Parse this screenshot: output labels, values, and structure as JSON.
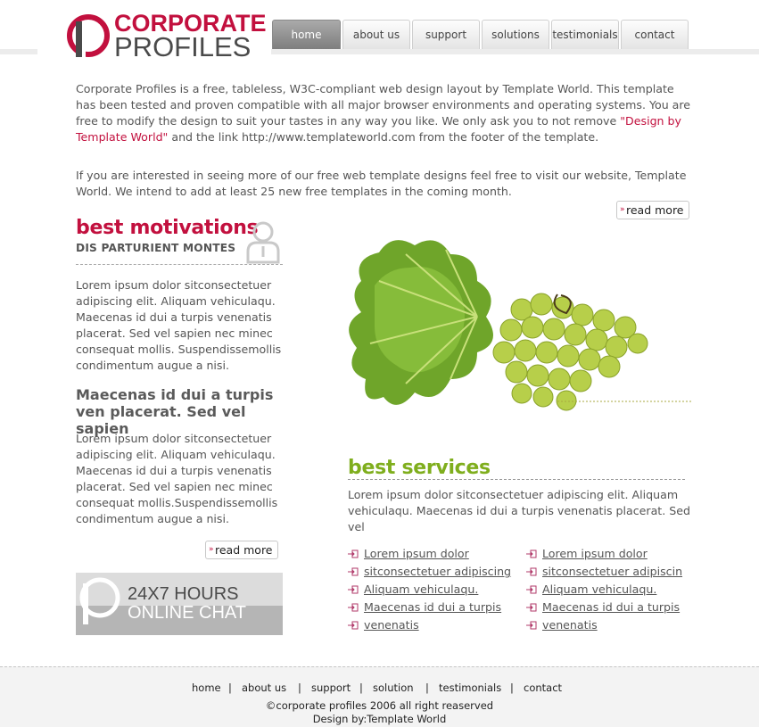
{
  "colors": {
    "brand_red": "#c2103e",
    "accent_green": "#7fae1d",
    "nav_active": "#8f8f8f",
    "text": "#555555"
  },
  "logo": {
    "line1": "CORPORATE",
    "line2": "PROFILES",
    "icon": "corporate-profiles-logo-icon"
  },
  "nav": {
    "items": [
      {
        "label": "home",
        "active": true
      },
      {
        "label": "about us",
        "active": false
      },
      {
        "label": "support",
        "active": false
      },
      {
        "label": "solutions",
        "active": false
      },
      {
        "label": "testimonials",
        "active": false
      },
      {
        "label": "contact",
        "active": false
      }
    ]
  },
  "intro": {
    "p1_before": "Corporate Profiles is a free, tableless, W3C-compliant web design layout by Template World. This template has been tested and proven compatible with all major browser environments and operating systems. You are free to modify the design to suit your tastes in any way you like. We only ask you to not remove ",
    "p1_highlight": "\"Design by Template World\"",
    "p1_after": " and the link http://www.templateworld.com from the footer of the template.",
    "p2": "If you are interested in seeing more of our free web template designs feel free to visit our website, Template World. We intend to add at least 25 new free templates in the coming month.",
    "read_more": "read more"
  },
  "motivations": {
    "title": "best motivations",
    "subtitle": "DIS PARTURIENT MONTES",
    "icon": "person-icon",
    "para1": "Lorem ipsum dolor sitconsectetuer adipiscing elit. Aliquam vehiculaqu. Maecenas id dui a turpis venenatis placerat. Sed vel sapien nec minec consequat mollis. Suspendissemollis condimentum augue a nisi.",
    "heading2": "Maecenas id dui a turpis ven placerat. Sed vel sapien",
    "para2": "Lorem ipsum dolor sitconsectetuer adipiscing elit. Aliquam vehiculaqu. Maecenas id dui a turpis venenatis placerat. Sed vel sapien nec minec consequat mollis.Suspendissemollis condimentum augue a nisi.",
    "read_more": "read more"
  },
  "chat_banner": {
    "line1": "24X7 HOURS",
    "line2": "ONLINE CHAT",
    "icon": "chat-logo-icon"
  },
  "hero_image": {
    "icon": "grapes-image"
  },
  "services": {
    "title": "best services",
    "text": "Lorem ipsum dolor sitconsectetuer adipiscing elit. Aliquam vehiculaqu. Maecenas id dui a turpis venenatis placerat. Sed vel",
    "list_left": [
      "Lorem ipsum dolor",
      "sitconsectetuer adipiscing",
      "Aliquam vehiculaqu.",
      "Maecenas id dui a turpis",
      "venenatis"
    ],
    "list_right": [
      "Lorem ipsum dolor",
      "sitconsectetuer adipiscin",
      "Aliquam vehiculaqu.",
      "Maecenas id dui a turpis",
      "venenatis"
    ],
    "bullet_icon": "arrow-box-icon"
  },
  "footer": {
    "links": [
      "home",
      "about us",
      "support",
      "solution",
      "testimonials",
      "contact"
    ],
    "separator": "|",
    "copyright": "©corporate profiles 2006 all right reaserved",
    "design_by": "Design by:Template World"
  }
}
